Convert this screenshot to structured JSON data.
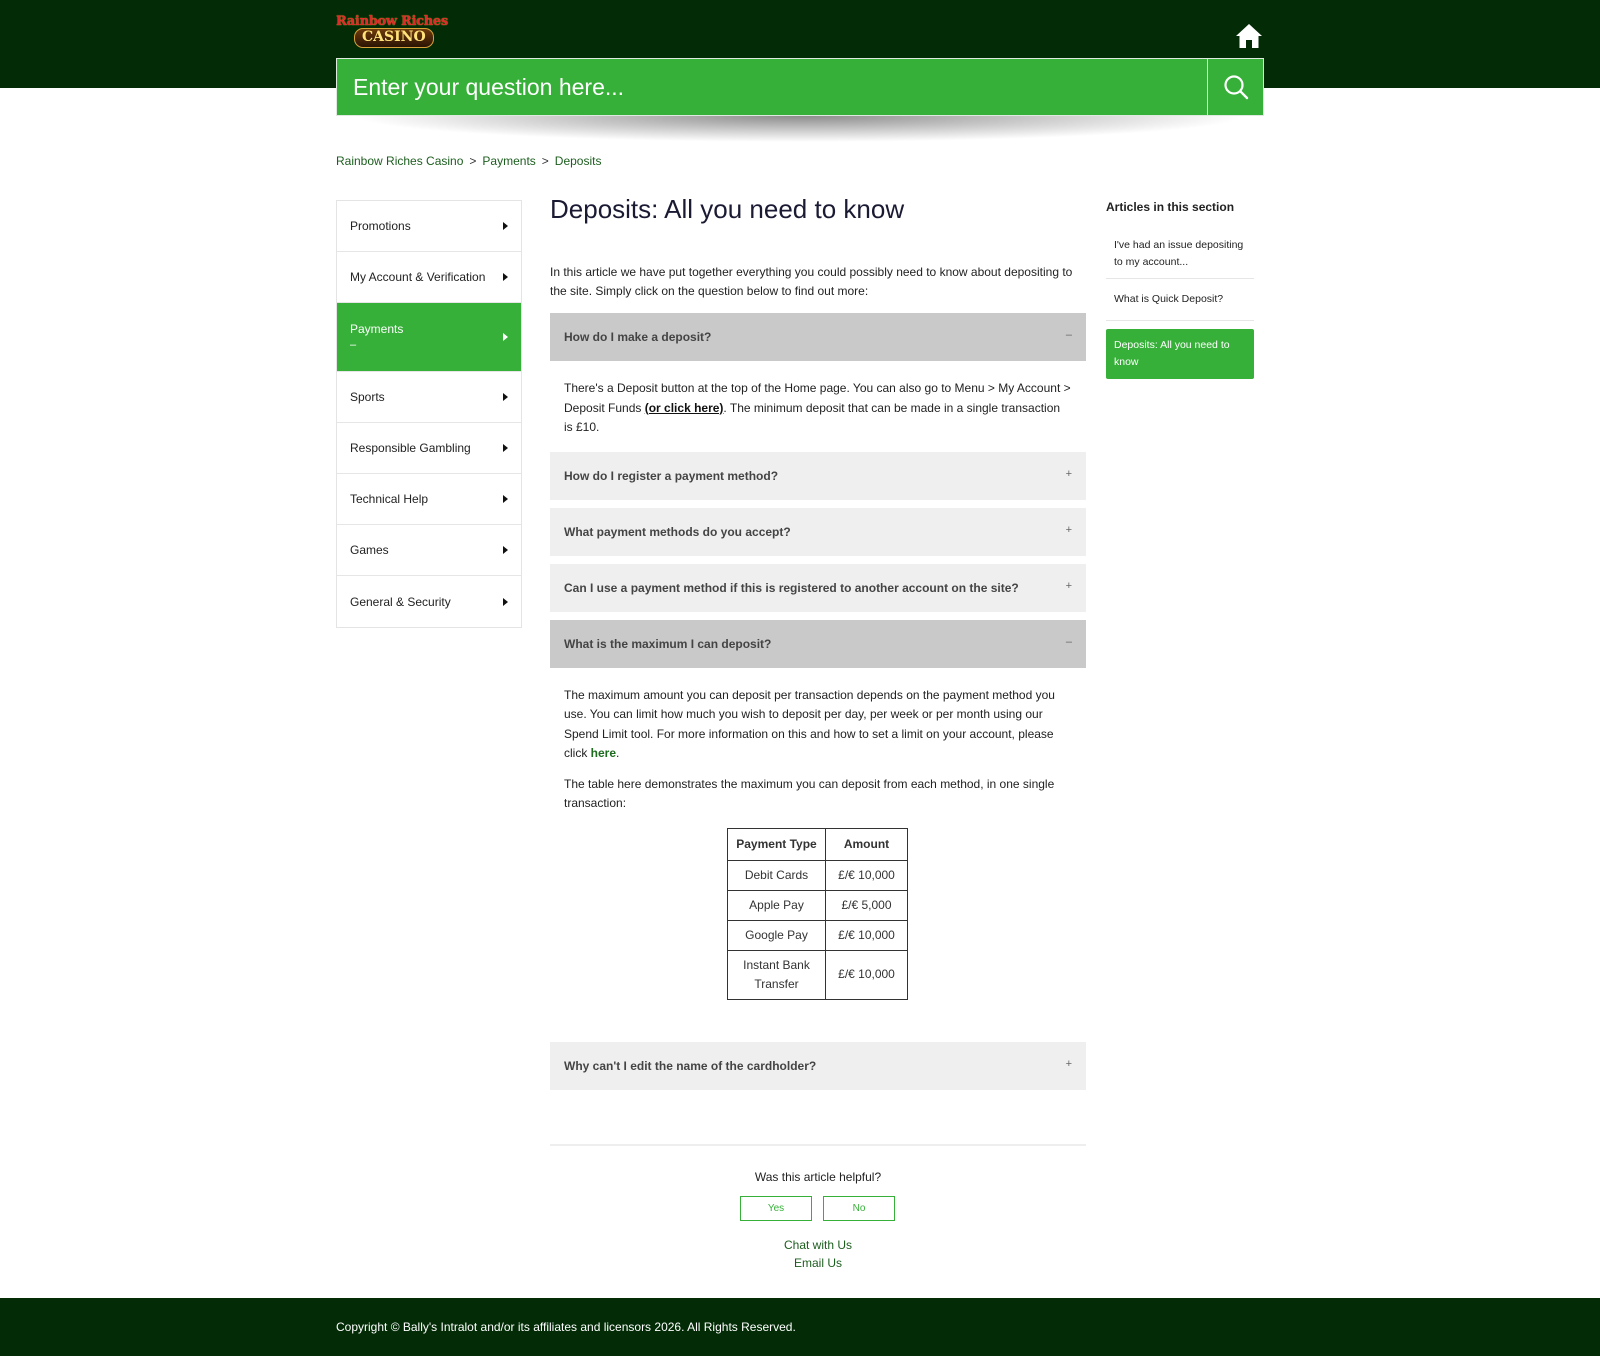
{
  "brand": {
    "logo_line1": "Rainbow Riches",
    "logo_line2": "CASINO"
  },
  "search": {
    "placeholder": "Enter your question here..."
  },
  "breadcrumb": [
    "Rainbow Riches Casino",
    "Payments",
    "Deposits"
  ],
  "breadcrumb_separator": ">",
  "nav": {
    "items": [
      {
        "label": "Promotions"
      },
      {
        "label": "My Account & Verification"
      },
      {
        "label": "Payments",
        "marker": "–"
      },
      {
        "label": "Sports"
      },
      {
        "label": "Responsible Gambling"
      },
      {
        "label": "Technical Help"
      },
      {
        "label": "Games"
      },
      {
        "label": "General & Security"
      }
    ]
  },
  "article": {
    "title": "Deposits: All you need to know",
    "intro": "In this article we have put together everything you could possibly need to know about depositing to the site. Simply click on the question below to find out more:",
    "faq": [
      {
        "question": "How do I make a deposit?",
        "indicator": "–",
        "answer_part1": "There's a Deposit button at the top of the Home page. You can also go to Menu > My Account > Deposit Funds ",
        "answer_link": "(or click here)",
        "answer_part2": ". The minimum deposit that can be made in a single transaction is £10."
      },
      {
        "question": "How do I register a payment method?",
        "indicator": "+"
      },
      {
        "question": "What payment methods do you accept?",
        "indicator": "+"
      },
      {
        "question": "Can I use a payment method if this is registered to another account on the site?",
        "indicator": "+"
      },
      {
        "question": "What is the maximum I can deposit?",
        "indicator": "–",
        "answer_part1": "The maximum amount you can deposit per transaction depends on the payment method you use. You can limit how much you wish to deposit per day, per week or per month using our Spend Limit tool. For more information on this and how to set a limit on your account, please click ",
        "answer_link": "here",
        "answer_part2": ".",
        "table_intro": "The table here demonstrates the maximum you can deposit from each method, in one single transaction:",
        "table": {
          "headers": [
            "Payment Type",
            "Amount"
          ],
          "rows": [
            [
              "Debit Cards",
              "£/€ 10,000"
            ],
            [
              "Apple Pay",
              "£/€ 5,000"
            ],
            [
              "Google Pay",
              "£/€ 10,000"
            ],
            [
              "Instant Bank Transfer",
              "£/€ 10,000"
            ]
          ]
        }
      },
      {
        "question": "Why can't I edit the name of the cardholder?",
        "indicator": "+"
      }
    ]
  },
  "feedback": {
    "question": "Was this article helpful?",
    "yes": "Yes",
    "no": "No",
    "chat": "Chat with Us",
    "email": "Email Us"
  },
  "sidebar": {
    "title": "Articles in this section",
    "items": [
      {
        "label": "I've had an issue depositing to my account..."
      },
      {
        "label": "What is Quick Deposit?"
      },
      {
        "label": "Deposits: All you need to know"
      }
    ]
  },
  "footer": {
    "copyright": "Copyright © Bally's Intralot and/or its affiliates and licensors 2026. All Rights Reserved."
  },
  "colors": {
    "header_bg": "#022b06",
    "accent_green": "#37b039",
    "open_accordion": "#c9c9c9",
    "closed_accordion": "#efefef"
  },
  "icons": [
    "home-icon",
    "search-icon",
    "caret-right-icon"
  ]
}
